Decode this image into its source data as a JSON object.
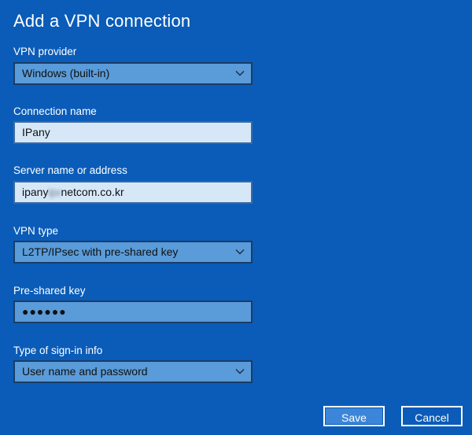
{
  "page_title": "Add a VPN connection",
  "fields": {
    "vpn_provider": {
      "label": "VPN provider",
      "value": "Windows (built-in)"
    },
    "connection_name": {
      "label": "Connection name",
      "value": "IPany"
    },
    "server_address": {
      "label": "Server name or address",
      "value_prefix": "ipany",
      "value_obscured": "ipanynetwork",
      "value_suffix": "netcom.co.kr"
    },
    "vpn_type": {
      "label": "VPN type",
      "value": "L2TP/IPsec with pre-shared key"
    },
    "pre_shared_key": {
      "label": "Pre-shared key",
      "masked_value": "●●●●●●"
    },
    "sign_in_type": {
      "label": "Type of sign-in info",
      "value": "User name and password"
    }
  },
  "buttons": {
    "save": "Save",
    "cancel": "Cancel"
  },
  "colors": {
    "background": "#0a5cb8",
    "dropdown_bg": "#5a9bd9",
    "input_bg": "#d6e8f8",
    "accent_button": "#3b86d8"
  },
  "icons": {
    "dropdown": "chevron-down-icon"
  }
}
